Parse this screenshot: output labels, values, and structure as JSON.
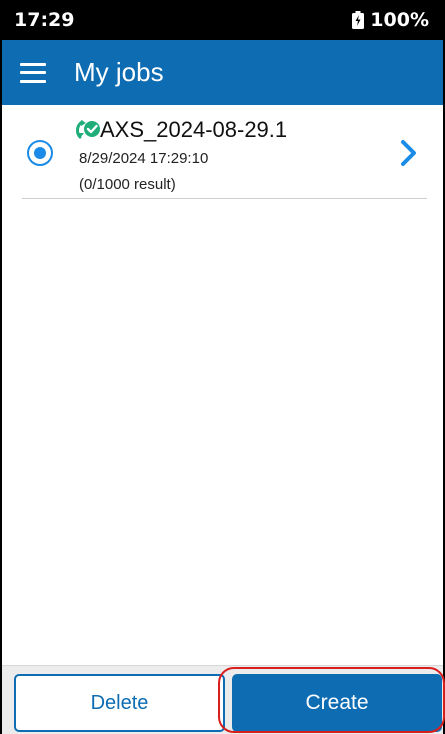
{
  "status_bar": {
    "time": "17:29",
    "battery": "100%"
  },
  "app_bar": {
    "title": "My jobs",
    "menu_icon": "hamburger-menu-icon"
  },
  "jobs": [
    {
      "name": "AXS_2024-08-29.1",
      "date": "8/29/2024 17:29:10",
      "results": "(0/1000 result)",
      "selected": true,
      "sync_icon": "sync-check-icon"
    }
  ],
  "actions": {
    "delete_label": "Delete",
    "create_label": "Create"
  },
  "colors": {
    "accent": "#0e6cb3",
    "radio": "#1a8be6",
    "sync_icon": "#1fae7a",
    "highlight": "#d91e1e"
  }
}
